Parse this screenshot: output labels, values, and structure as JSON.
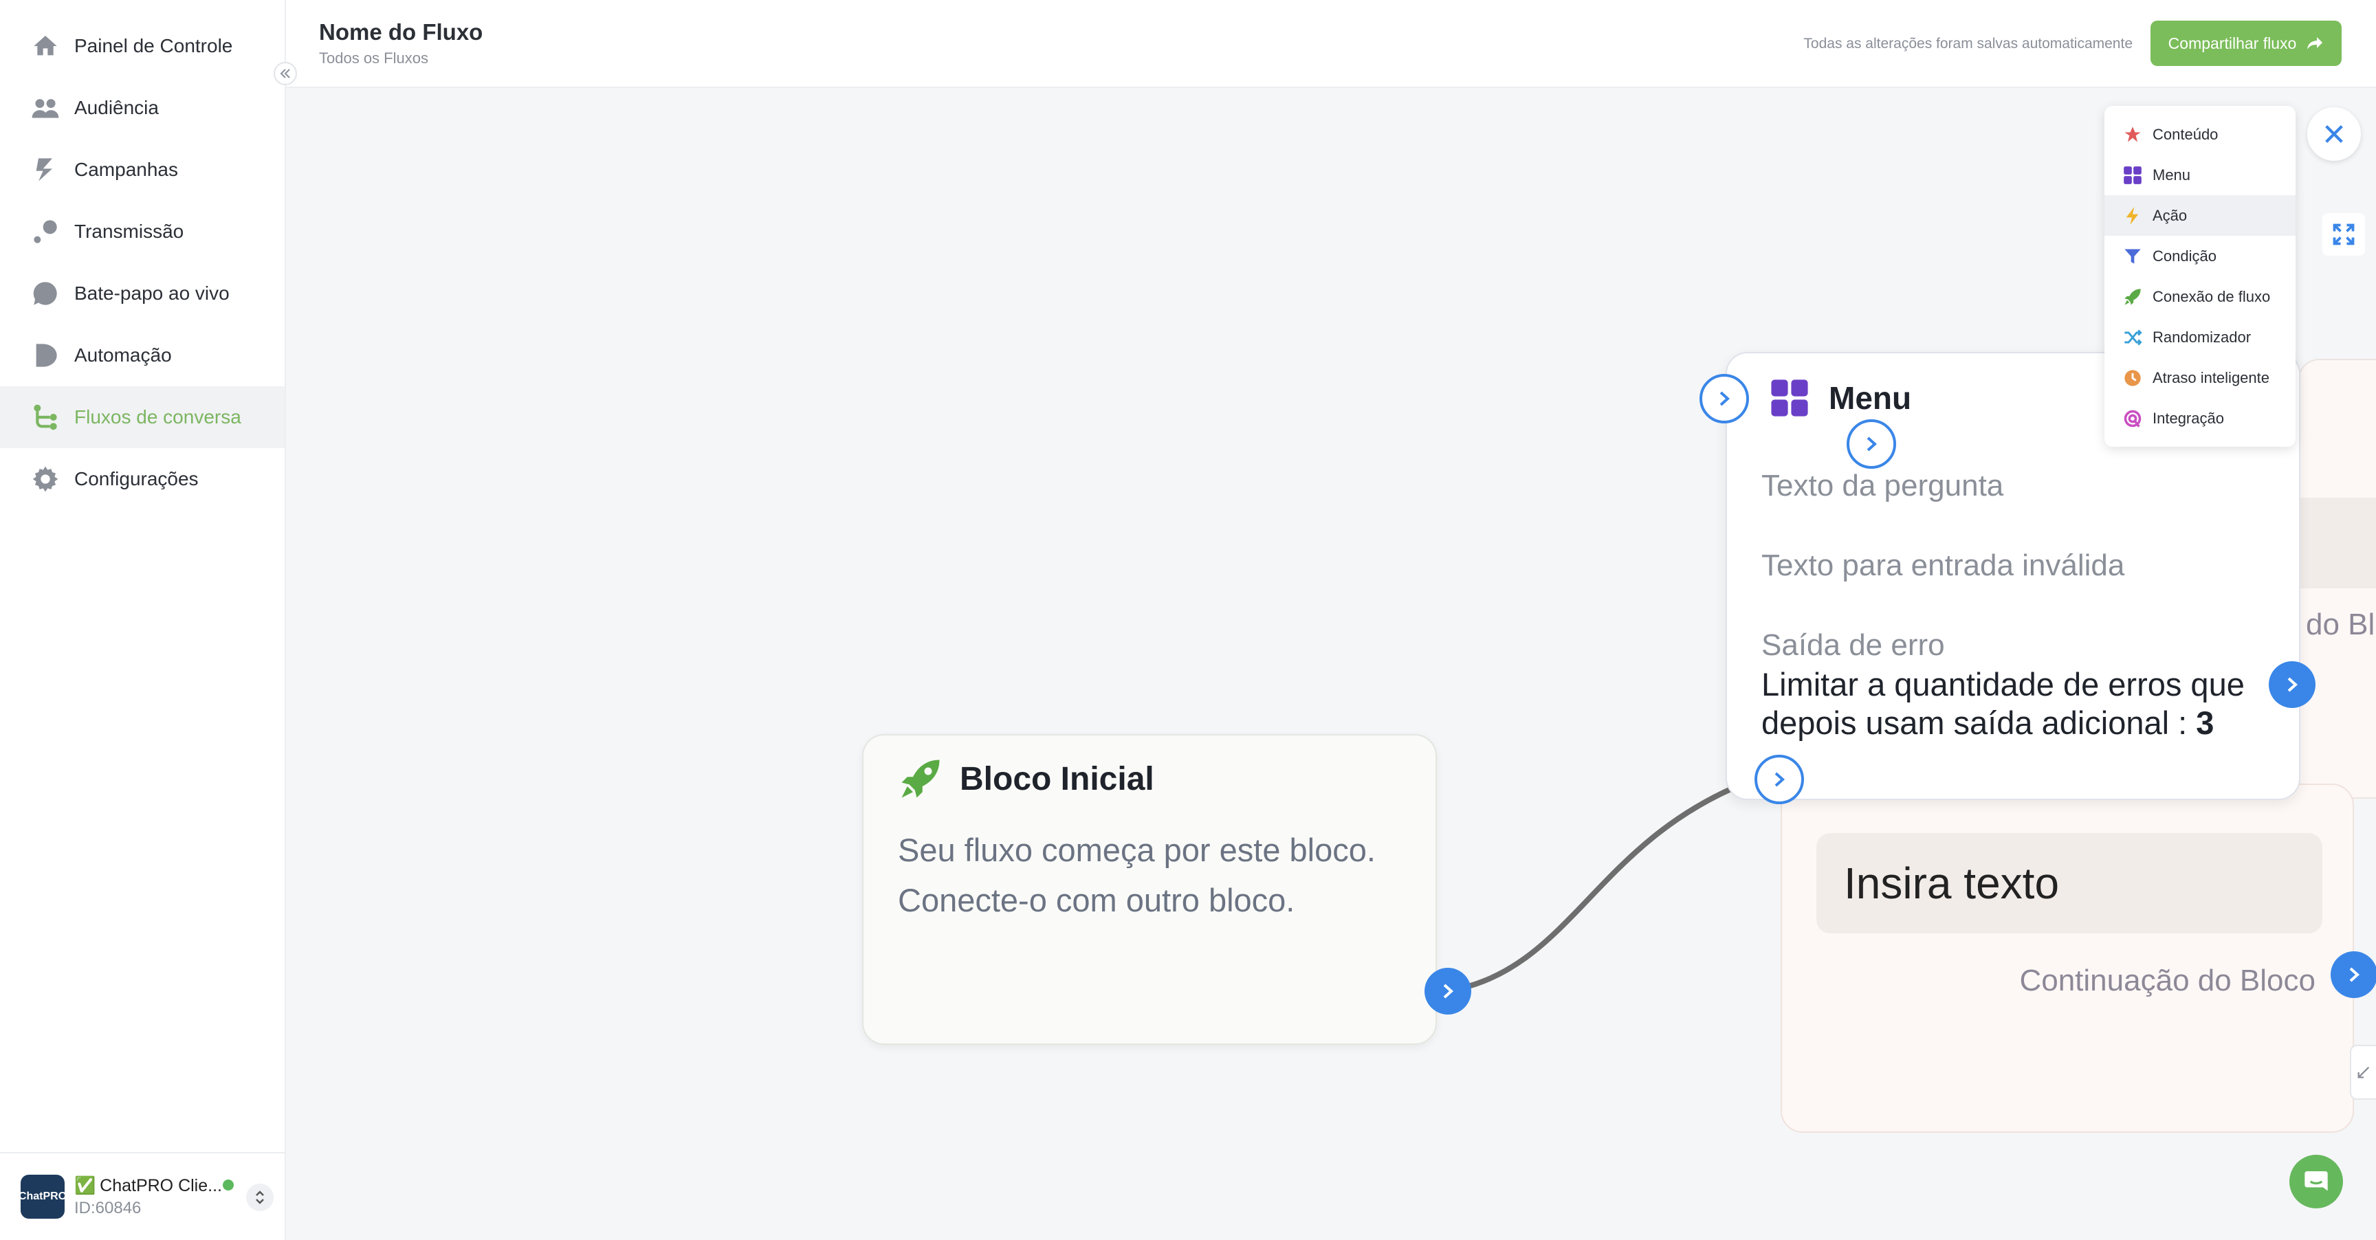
{
  "sidebar": {
    "items": [
      {
        "label": "Painel de Controle",
        "icon": "home-icon"
      },
      {
        "label": "Audiência",
        "icon": "users-icon"
      },
      {
        "label": "Campanhas",
        "icon": "lightning-icon"
      },
      {
        "label": "Transmissão",
        "icon": "broadcast-icon"
      },
      {
        "label": "Bate-papo ao vivo",
        "icon": "chat-icon"
      },
      {
        "label": "Automação",
        "icon": "play-icon"
      },
      {
        "label": "Fluxos de conversa",
        "icon": "flow-icon",
        "active": true
      },
      {
        "label": "Configurações",
        "icon": "gear-icon"
      }
    ],
    "collapse_label": "«",
    "account": {
      "name": "ChatPRO Clie...",
      "verified_badge": "✅",
      "id": "ID:60846",
      "avatar_text": "ChatPRO",
      "status_color": "#5cb85c"
    }
  },
  "header": {
    "title": "Nome do Fluxo",
    "breadcrumb": "Todos os Fluxos",
    "save_status": "Todas as alterações foram salvas automaticamente",
    "share_label": "Compartilhar fluxo"
  },
  "canvas": {
    "start_block": {
      "title": "Bloco Inicial",
      "description": "Seu fluxo começa por este bloco. Conecte-o com outro bloco."
    },
    "content_block": {
      "input_text": "Insira texto",
      "continuation": "Continuação do Bloco"
    },
    "back_block": {
      "label": "do Blo"
    },
    "menu_block": {
      "title": "Menu",
      "question_text": "Texto da pergunta",
      "invalid_text": "Texto para entrada inválida",
      "error_exit": "Saída de erro",
      "error_limit_text": "Limitar a quantidade de erros que depois usam saída adicional :",
      "error_limit_value": "3"
    }
  },
  "dropdown": {
    "items": [
      {
        "label": "Conteúdo",
        "icon": "star-icon",
        "color": "#e15b5b"
      },
      {
        "label": "Menu",
        "icon": "grid-icon",
        "color": "#6a3fc7"
      },
      {
        "label": "Ação",
        "icon": "bolt-icon",
        "color": "#f0b429",
        "hover": true
      },
      {
        "label": "Condição",
        "icon": "filter-icon",
        "color": "#4a6bd8"
      },
      {
        "label": "Conexão de fluxo",
        "icon": "rocket-icon",
        "color": "#5aaa45"
      },
      {
        "label": "Randomizador",
        "icon": "shuffle-icon",
        "color": "#3aa0d8"
      },
      {
        "label": "Atraso inteligente",
        "icon": "clock-icon",
        "color": "#e8964a"
      },
      {
        "label": "Integração",
        "icon": "integration-icon",
        "color": "#c94fc2"
      }
    ]
  },
  "colors": {
    "accent_green": "#7bbd5a",
    "accent_blue": "#3a86e8",
    "menu_purple": "#6a3fc7"
  }
}
